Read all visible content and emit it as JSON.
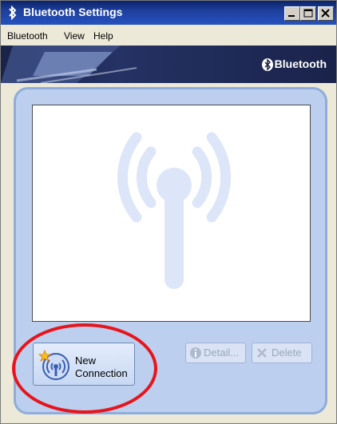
{
  "window": {
    "title": "Bluetooth Settings"
  },
  "menu": [
    "Bluetooth",
    "View",
    "Help"
  ],
  "banner": {
    "brand": "Bluetooth"
  },
  "actions": {
    "new_connection": {
      "line1": "New",
      "line2": "Connection"
    },
    "detail": "Detail...",
    "delete": "Delete"
  },
  "colors": {
    "titlebar": "#0a246a",
    "panel": "#bccfee",
    "highlight_circle": "#e8141b"
  },
  "icons": [
    "bluetooth-icon",
    "minimize-icon",
    "maximize-icon",
    "close-icon",
    "antenna-watermark-icon",
    "new-connection-icon",
    "info-icon",
    "delete-x-icon"
  ]
}
